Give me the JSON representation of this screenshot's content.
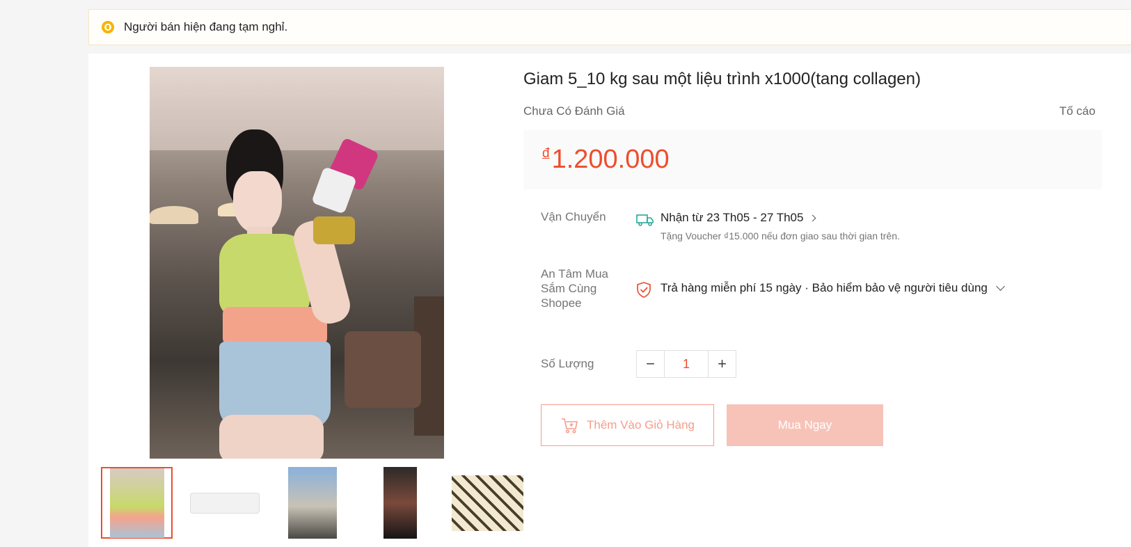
{
  "notice": {
    "text": "Người bán hiện đang tạm nghỉ."
  },
  "product": {
    "title": "Giam 5_10 kg sau một liệu trình x1000(tang collagen)",
    "rating_text": "Chưa Có Đánh Giá",
    "report_label": "Tố cáo",
    "currency_symbol": "đ",
    "price": "1.200.000",
    "thumbnails": [
      "thumbnail-1",
      "thumbnail-2",
      "thumbnail-3",
      "thumbnail-4",
      "thumbnail-5"
    ]
  },
  "shipping": {
    "label": "Vận Chuyển",
    "main": "Nhận từ 23 Th05 - 27 Th05",
    "sub": "Tặng Voucher ₫15.000 nếu đơn giao sau thời gian trên."
  },
  "guarantee": {
    "label_lines": [
      "An Tâm Mua",
      "Sắm Cùng",
      "Shopee"
    ],
    "text": "Trả hàng miễn phí 15 ngày · Bảo hiểm bảo vệ người tiêu dùng"
  },
  "quantity": {
    "label": "Số Lượng",
    "value": "1",
    "minus": "−",
    "plus": "+"
  },
  "actions": {
    "add_to_cart": "Thêm Vào Giỏ Hàng",
    "buy_now": "Mua Ngay"
  },
  "colors": {
    "accent": "#ee4d2d",
    "notice_icon": "#f7b500",
    "shipping_icon": "#26aa99"
  }
}
